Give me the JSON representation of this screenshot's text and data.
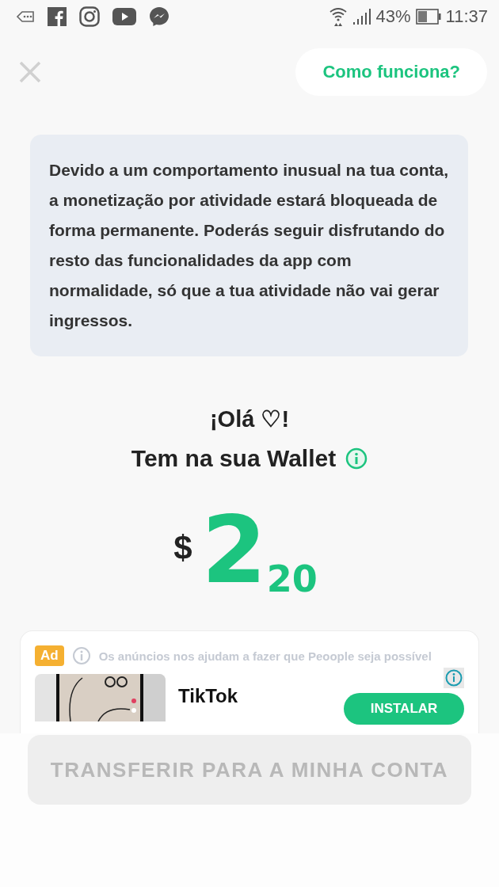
{
  "status_bar": {
    "battery_percent": "43%",
    "time": "11:37"
  },
  "header": {
    "help_button": "Como funciona?"
  },
  "notice": "Devido a um comportamento inusual na tua conta, a monetização por atividade estará bloqueada de forma permanente. Poderás seguir disfrutando do resto das funcionalidades da app com normalidade, só que a tua atividade não vai gerar ingressos.",
  "greeting": "¡Olá ♡!",
  "wallet_label": "Tem na sua Wallet",
  "balance": {
    "currency": "$",
    "units": "2",
    "cents": "20"
  },
  "ad": {
    "badge": "Ad",
    "disclaimer": "Os anúncios nos ajudam a fazer que Peoople seja possível",
    "app_name": "TikTok",
    "install_button": "INSTALAR"
  },
  "transfer_button": {
    "label": "TRANSFERIR PARA A MINHA CONTA",
    "disabled": true
  }
}
